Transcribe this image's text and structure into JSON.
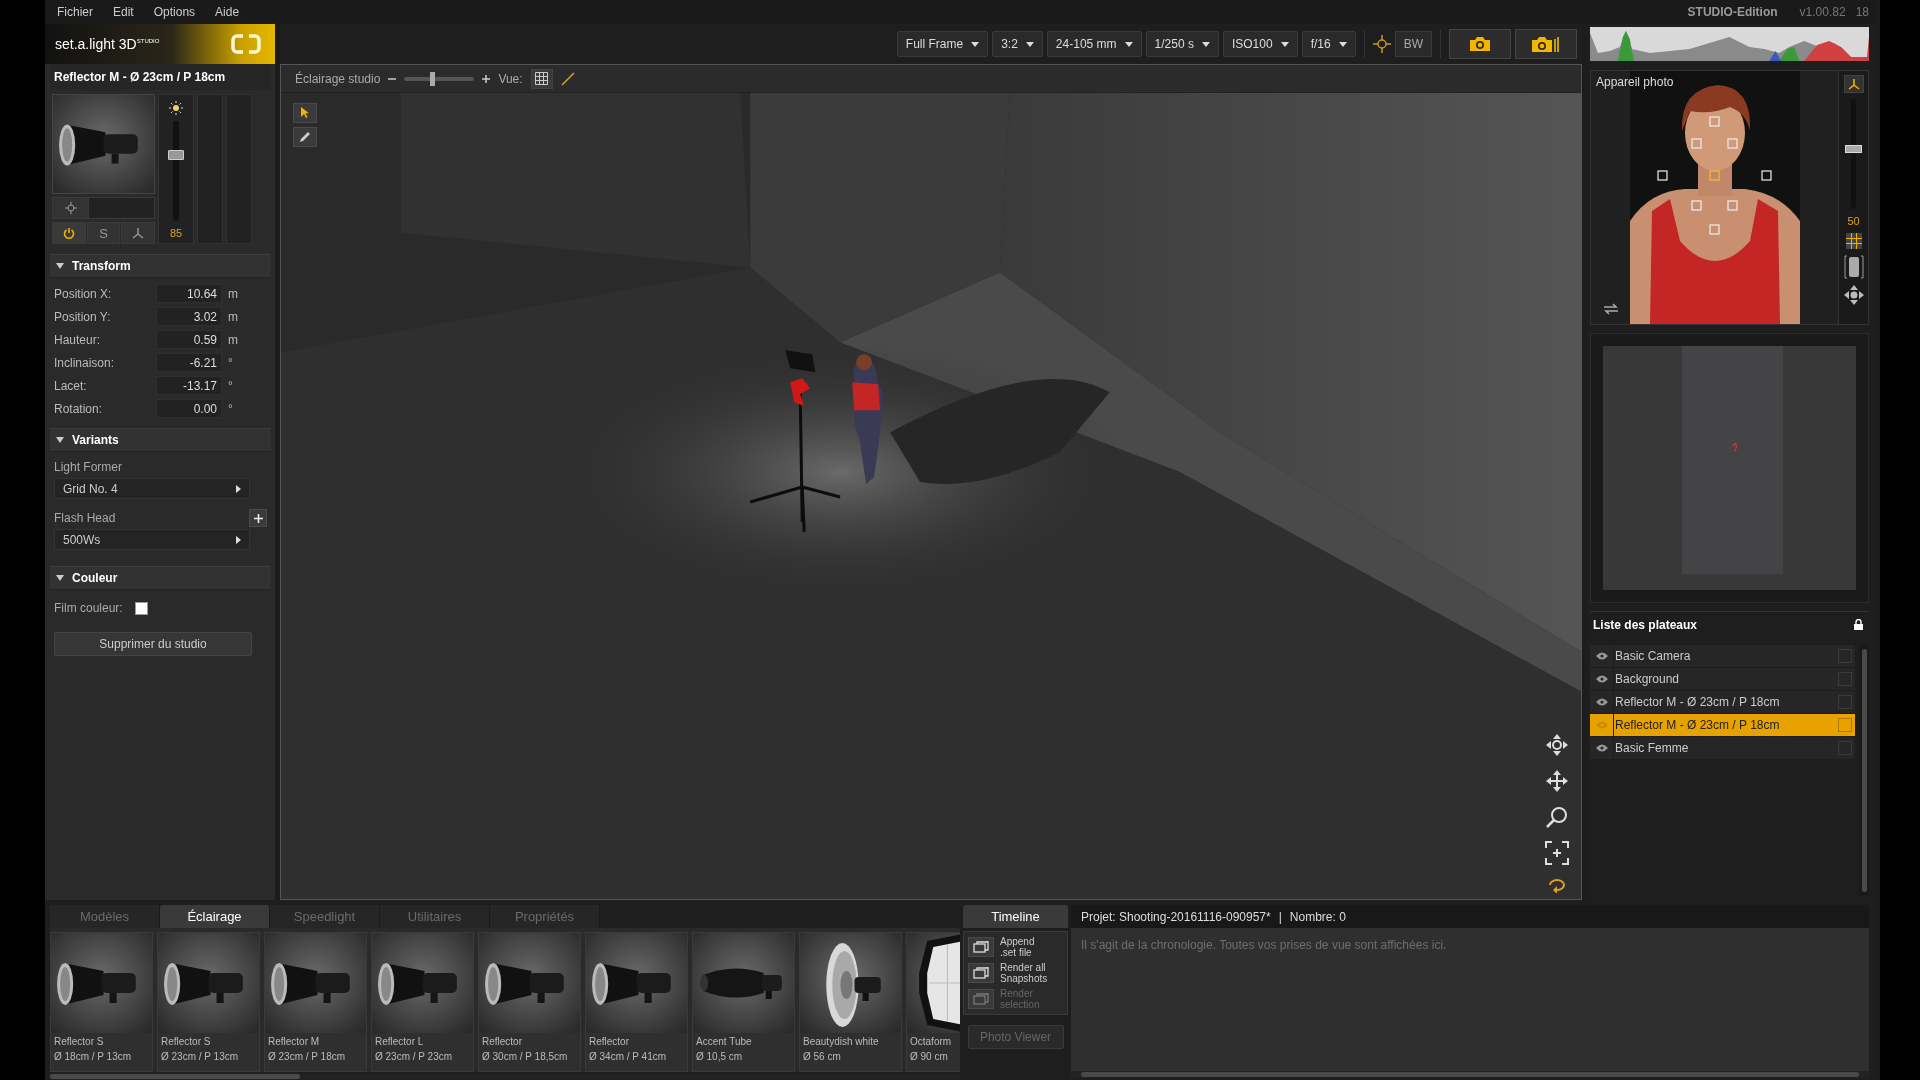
{
  "menu": [
    {
      "label": "Fichier"
    },
    {
      "label": "Edit"
    },
    {
      "label": "Options"
    },
    {
      "label": "Aide"
    }
  ],
  "edition": {
    "name": "STUDIO-Edition",
    "version": "v1.00.82",
    "build": "18"
  },
  "logo": {
    "text": "set.a.light 3D$^{STUDIO}$"
  },
  "camera_settings": [
    {
      "label": "Full Frame"
    },
    {
      "label": "3:2"
    },
    {
      "label": "24-105 mm"
    },
    {
      "label": "1/250 s"
    },
    {
      "label": "ISO100"
    },
    {
      "label": "f/16"
    }
  ],
  "bw_button": "BW",
  "light": {
    "title": "Reflector M - Ø 23cm / P 18cm",
    "power": "85",
    "level": 0.68,
    "buttons": [
      {
        "kind": "power",
        "on": true
      },
      {
        "kind": "solo",
        "label": "S",
        "on": false
      },
      {
        "kind": "stand",
        "on": false
      }
    ]
  },
  "transform": {
    "title": "Transform",
    "expanded": true,
    "fields": [
      {
        "label": "Position X:",
        "value": "10.64",
        "unit": "m"
      },
      {
        "label": "Position Y:",
        "value": "3.02",
        "unit": "m"
      },
      {
        "label": "Hauteur:",
        "value": "0.59",
        "unit": "m"
      },
      {
        "label": "Inclinaison:",
        "value": "-6.21",
        "unit": "°"
      },
      {
        "label": "Lacet:",
        "value": "-13.17",
        "unit": "°"
      },
      {
        "label": "Rotation:",
        "value": "0.00",
        "unit": "°"
      }
    ]
  },
  "variants": {
    "title": "Variants",
    "expanded": true,
    "light_former": {
      "label": "Light Former",
      "value": "Grid No. 4"
    },
    "flash_head": {
      "label": "Flash Head",
      "value": "500Ws"
    }
  },
  "couleur": {
    "title": "Couleur",
    "expanded": true,
    "film": {
      "label": "Film couleur:",
      "color": "#ffffff"
    }
  },
  "delete_button": "Supprimer du studio",
  "viewport": {
    "title": "Éclairage studio",
    "zoom": {
      "level": 0.4
    },
    "view_label": "Vue:"
  },
  "camera_preview": {
    "title": "Appareil photo",
    "zoom": "50",
    "level": 0.55
  },
  "layers": {
    "title": "Liste des plateaux",
    "items": [
      {
        "name": "Basic Camera",
        "selected": false
      },
      {
        "name": "Background",
        "selected": false
      },
      {
        "name": "Reflector M - Ø 23cm / P 18cm",
        "selected": false
      },
      {
        "name": "Reflector M - Ø 23cm / P 18cm",
        "selected": true
      },
      {
        "name": "Basic Femme",
        "selected": false
      }
    ]
  },
  "library": {
    "tabs": [
      {
        "label": "Modèles",
        "selected": false
      },
      {
        "label": "Éclairage",
        "selected": true
      },
      {
        "label": "Speedlight",
        "selected": false
      },
      {
        "label": "Utilitaires",
        "selected": false
      },
      {
        "label": "Propriétés",
        "selected": false
      }
    ],
    "items": [
      {
        "kind": "reflector",
        "name": "Reflector S",
        "size": "Ø 18cm / P 13cm"
      },
      {
        "kind": "reflector",
        "name": "Reflector S",
        "size": "Ø 23cm / P 13cm"
      },
      {
        "kind": "reflector",
        "name": "Reflector M",
        "size": "Ø 23cm / P 18cm"
      },
      {
        "kind": "reflector",
        "name": "Reflector L",
        "size": "Ø 23cm / P 23cm"
      },
      {
        "kind": "reflector",
        "name": "Reflector",
        "size": "Ø 30cm / P 18,5cm"
      },
      {
        "kind": "reflector",
        "name": "Reflector",
        "size": "Ø 34cm / P 41cm"
      },
      {
        "kind": "tube",
        "name": "Accent Tube",
        "size": "Ø 10,5 cm"
      },
      {
        "kind": "dish",
        "name": "Beautydish white",
        "size": "Ø 56 cm"
      },
      {
        "kind": "octabox",
        "name": "Octaform",
        "size": "Ø 90 cm"
      }
    ]
  },
  "timeline": {
    "title": "Timeline",
    "actions": [
      {
        "label": "Append\n.set file",
        "disabled": false
      },
      {
        "label": "Render all\nSnapshots",
        "disabled": false
      },
      {
        "label": "Render\nselection",
        "disabled": true
      }
    ],
    "photo_viewer": {
      "label": "Photo Viewer",
      "disabled": true
    }
  },
  "project": {
    "name": "Projet: Shooting-20161116-090957*",
    "separator": "|",
    "count": "Nombre: 0",
    "message": "Il s'agit de la chronologie. Toutes vos prises de vue sont affichées ici."
  }
}
